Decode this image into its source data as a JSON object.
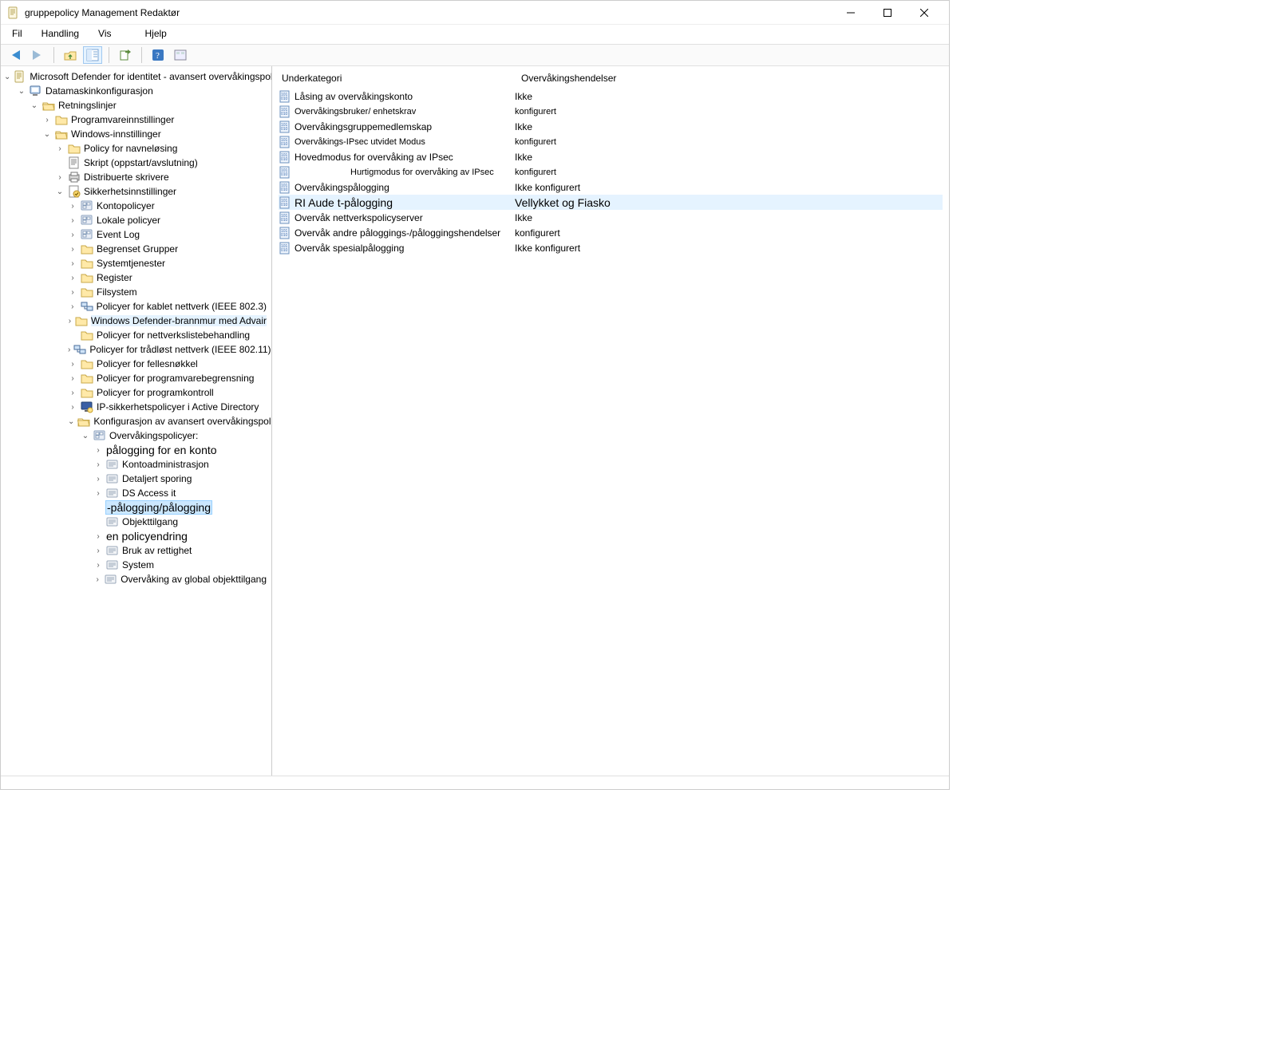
{
  "window": {
    "title": "gruppepolicy Management Redaktør"
  },
  "menubar": {
    "file": "Fil",
    "action": "Handling",
    "view": "Vis",
    "help": "Hjelp"
  },
  "tree": {
    "root": "Microsoft Defender for identitet - avansert overvåkingspolicy",
    "computer_config": "Datamaskinkonfigurasjon",
    "policies": "Retningslinjer",
    "software_settings": "Programvareinnstillinger",
    "windows_settings": "Windows-innstillinger",
    "name_res_policy": "Policy for navneløsing",
    "scripts": "Skript (oppstart/avslutning)",
    "deployed_printers": "Distribuerte skrivere",
    "security_settings": "Sikkerhetsinnstillinger",
    "account_policies": "Kontopolicyer",
    "local_policies": "Lokale policyer",
    "event_log": "Event Log",
    "restricted_groups": "Begrenset Grupper",
    "system_services": "Systemtjenester",
    "registry": "Register",
    "file_system": "Filsystem",
    "wired": "Policyer for kablet nettverk (IEEE 802.3)",
    "firewall": "Windows Defender-brannmur med Advair",
    "netlist": "Policyer for nettverkslistebehandling",
    "wireless": "Policyer for trådløst nettverk (IEEE 802.11)",
    "public_key": "Policyer for fellesnøkkel",
    "sw_restriction": "Policyer for programvarebegrensning",
    "app_control": "Policyer for programkontroll",
    "ipsec_ad": "IP-sikkerhetspolicyer i Active Directory",
    "adv_audit": "Konfigurasjon av avansert overvåkingspolicy",
    "audit_policies": "Overvåkingspolicyer:",
    "account_logon": "pålogging for en konto",
    "account_management": "Kontoadministrasjon",
    "detailed_tracking": "Detaljert sporing",
    "ds_access": "DS Access it",
    "logon_logoff": "-pålogging/pålogging",
    "object_access": "Objekttilgang",
    "policy_change": "en policyendring",
    "privilege_use": "Bruk av rettighet",
    "system": "System",
    "global_object": "Overvåking av global objekttilgang"
  },
  "detail": {
    "col_sub": "Underkategori",
    "col_evt": "Overvåkingshendelser",
    "rows": [
      {
        "sub": "Låsing av overvåkingskonto",
        "evt": "Ikke"
      },
      {
        "sub": "Overvåkingsbruker/ enhetskrav",
        "evt": "konfigurert",
        "small": true
      },
      {
        "sub": "Overvåkingsgruppemedlemskap",
        "evt": "Ikke"
      },
      {
        "sub": "Overvåkings-IPsec utvidet   Modus",
        "evt": "konfigurert",
        "small": true
      },
      {
        "sub": "Hovedmodus for overvåking av IPsec",
        "evt": "Ikke"
      },
      {
        "sub": "Hurtigmodus for overvåking av IPsec",
        "evt": "konfigurert",
        "small": true,
        "indent": true
      },
      {
        "sub": "Overvåkingspålogging",
        "evt": "Ikke konfigurert"
      },
      {
        "sub": "RI Aude t-pålogging",
        "evt": "Vellykket og   Fiasko",
        "selected": true
      },
      {
        "sub": "Overvåk nettverkspolicyserver",
        "evt": "Ikke"
      },
      {
        "sub": "Overvåk andre påloggings-/påloggingshendelser",
        "evt": "konfigurert"
      },
      {
        "sub": "Overvåk spesialpålogging",
        "evt": "Ikke konfigurert"
      }
    ]
  }
}
